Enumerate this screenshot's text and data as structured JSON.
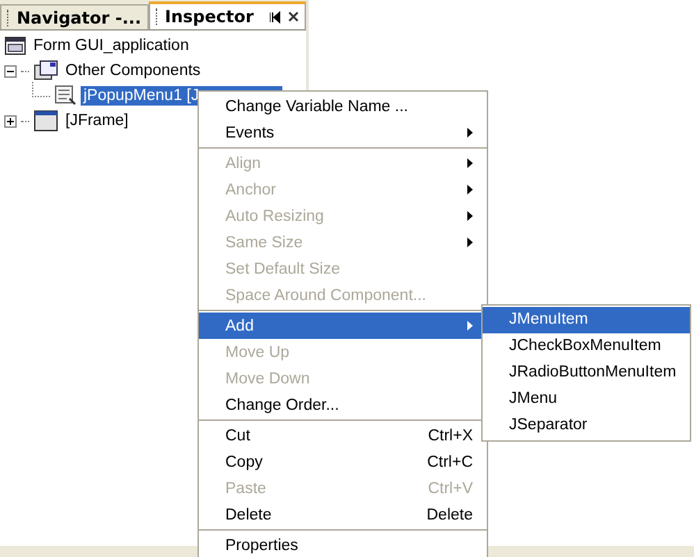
{
  "tabs": [
    {
      "label": "Navigator -...",
      "selected": false
    },
    {
      "label": "Inspector",
      "selected": true
    }
  ],
  "tree": [
    {
      "label": "Form GUI_application",
      "kind": "form",
      "children": [
        {
          "label": "Other Components",
          "kind": "components",
          "expanded": true,
          "selected": false,
          "children": [
            {
              "label": "jPopupMenu1 [J",
              "kind": "menu",
              "selected": true
            }
          ]
        },
        {
          "label": "[JFrame]",
          "kind": "frame",
          "expanded": false,
          "selected": false
        }
      ]
    }
  ],
  "context_menu": {
    "sections": [
      [
        {
          "label": "Change Variable Name ...",
          "disabled": false,
          "submenu": false,
          "selected": false
        },
        {
          "label": "Events",
          "disabled": false,
          "submenu": true,
          "selected": false
        }
      ],
      [
        {
          "label": "Align",
          "disabled": true,
          "submenu": true,
          "selected": false
        },
        {
          "label": "Anchor",
          "disabled": true,
          "submenu": true,
          "selected": false
        },
        {
          "label": "Auto Resizing",
          "disabled": true,
          "submenu": true,
          "selected": false
        },
        {
          "label": "Same Size",
          "disabled": true,
          "submenu": true,
          "selected": false
        },
        {
          "label": "Set Default Size",
          "disabled": true,
          "submenu": false,
          "selected": false
        },
        {
          "label": "Space Around Component...",
          "disabled": true,
          "submenu": false,
          "selected": false
        }
      ],
      [
        {
          "label": "Add",
          "disabled": false,
          "submenu": true,
          "selected": true
        },
        {
          "label": "Move Up",
          "disabled": true,
          "submenu": false,
          "selected": false
        },
        {
          "label": "Move Down",
          "disabled": true,
          "submenu": false,
          "selected": false
        },
        {
          "label": "Change Order...",
          "disabled": false,
          "submenu": false,
          "selected": false
        }
      ],
      [
        {
          "label": "Cut",
          "shortcut": "Ctrl+X",
          "disabled": false,
          "submenu": false,
          "selected": false
        },
        {
          "label": "Copy",
          "shortcut": "Ctrl+C",
          "disabled": false,
          "submenu": false,
          "selected": false
        },
        {
          "label": "Paste",
          "shortcut": "Ctrl+V",
          "disabled": true,
          "submenu": false,
          "selected": false
        },
        {
          "label": "Delete",
          "shortcut": "Delete",
          "disabled": false,
          "submenu": false,
          "selected": false
        }
      ],
      [
        {
          "label": "Properties",
          "disabled": false,
          "submenu": false,
          "selected": false
        }
      ]
    ]
  },
  "submenu": [
    {
      "label": "JMenuItem",
      "selected": true
    },
    {
      "label": "JCheckBoxMenuItem",
      "selected": false
    },
    {
      "label": "JRadioButtonMenuItem",
      "selected": false
    },
    {
      "label": "JMenu",
      "selected": false
    },
    {
      "label": "JSeparator",
      "selected": false
    }
  ]
}
